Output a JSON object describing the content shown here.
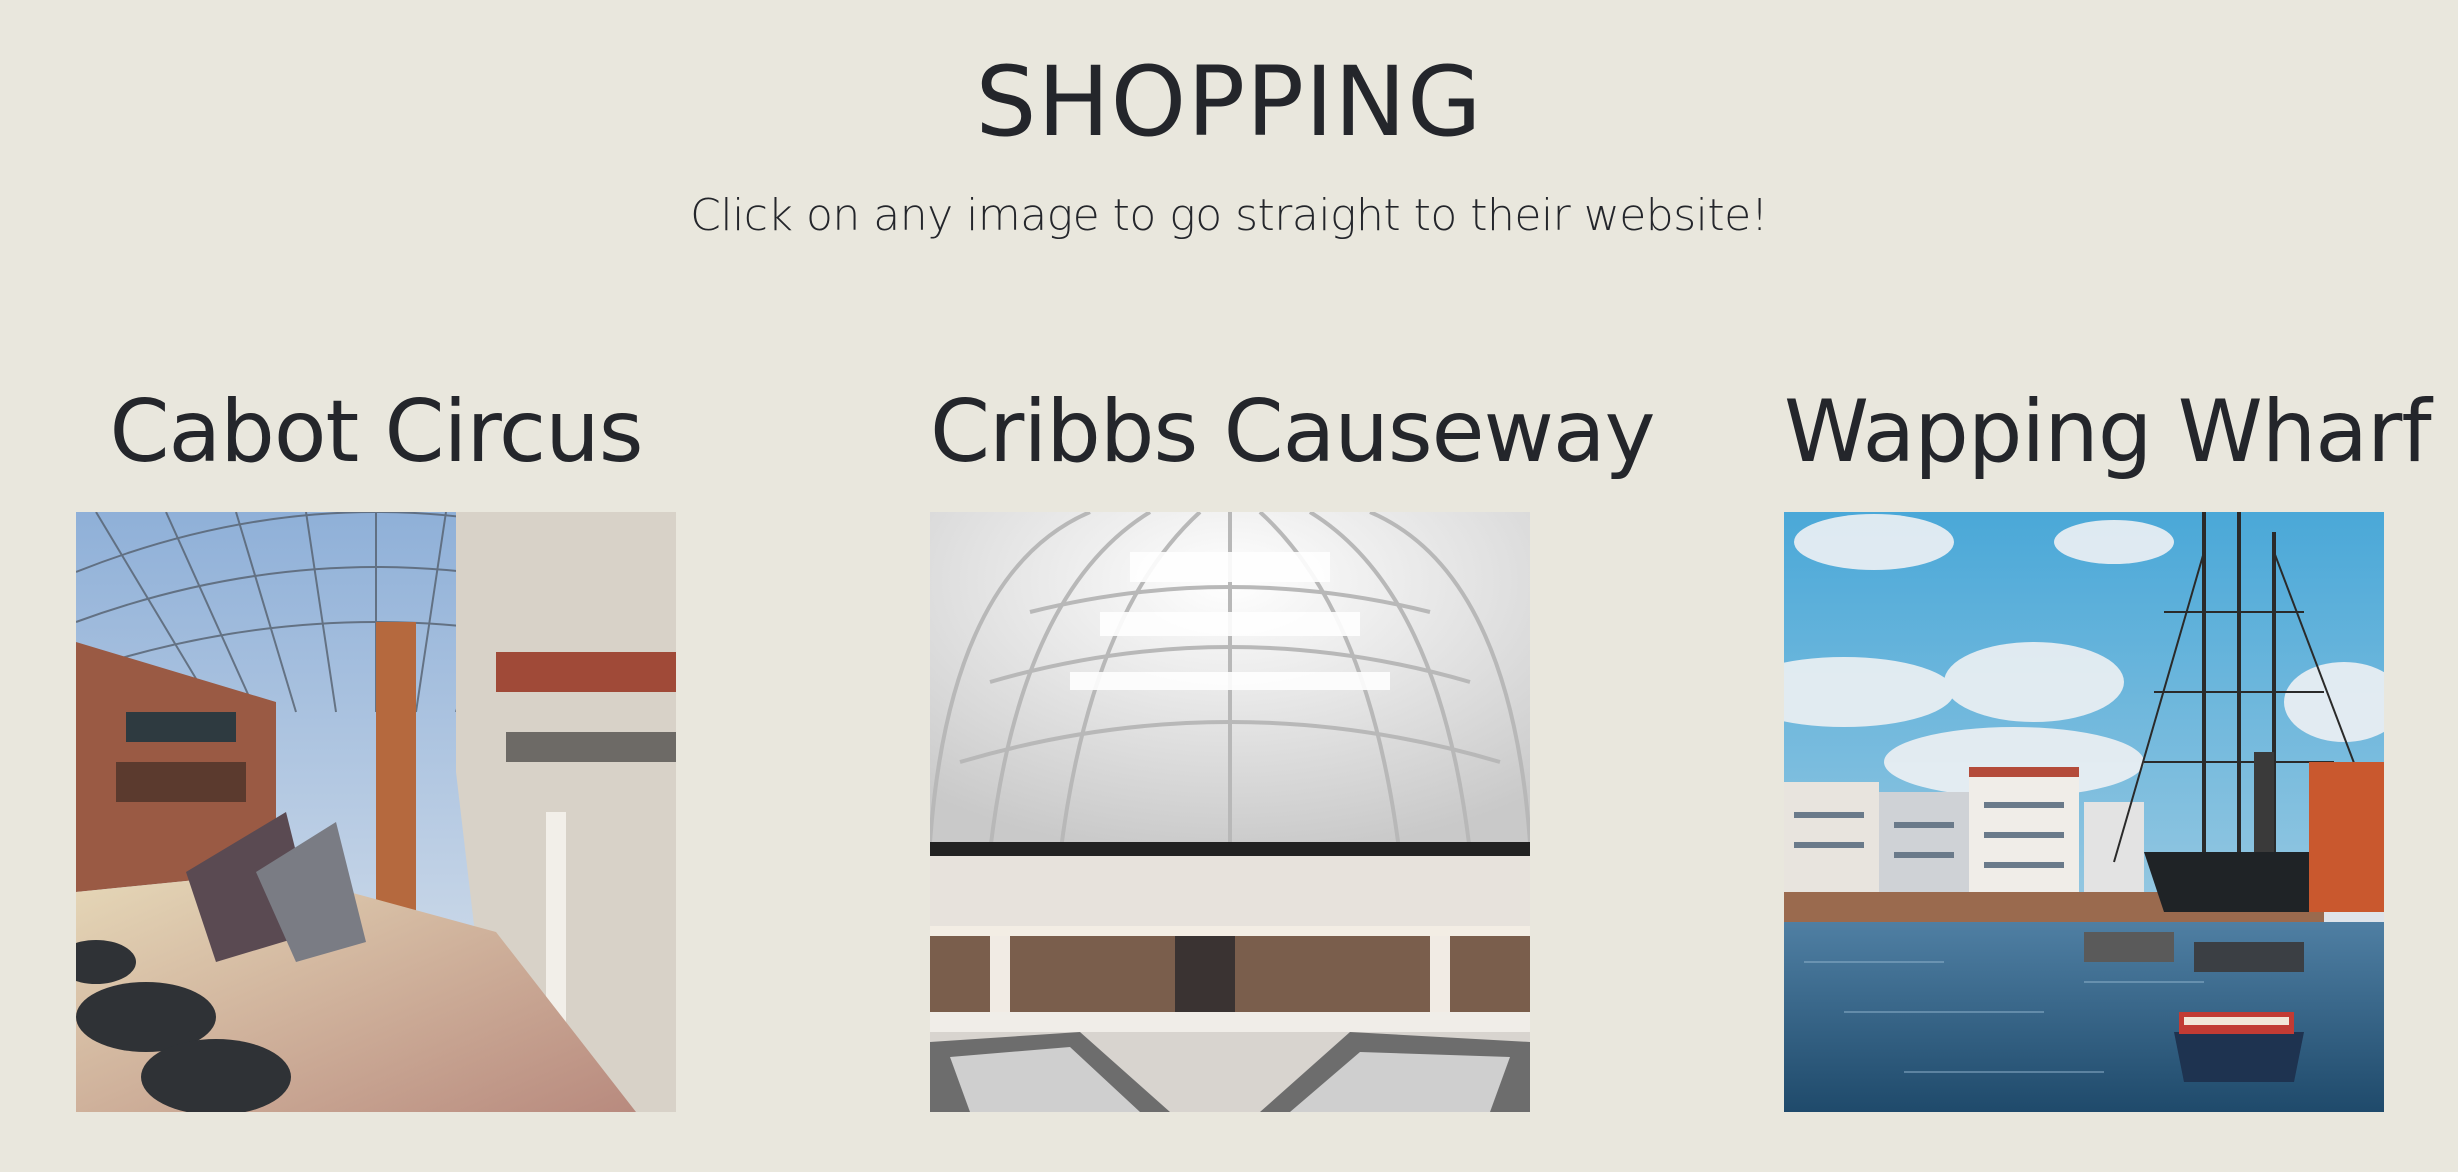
{
  "header": {
    "title": "SHOPPING",
    "subtitle": "Click on any image to go straight to their website!"
  },
  "cards": [
    {
      "title": "Cabot Circus",
      "image_alt": "Cabot Circus shopping centre interior"
    },
    {
      "title": "Cribbs Causeway",
      "image_alt": "Cribbs Causeway mall atrium"
    },
    {
      "title": "Wapping Wharf",
      "image_alt": "Wapping Wharf harbour with tall ship"
    }
  ],
  "colors": {
    "background": "#e9e7dd",
    "text": "#24262b"
  }
}
